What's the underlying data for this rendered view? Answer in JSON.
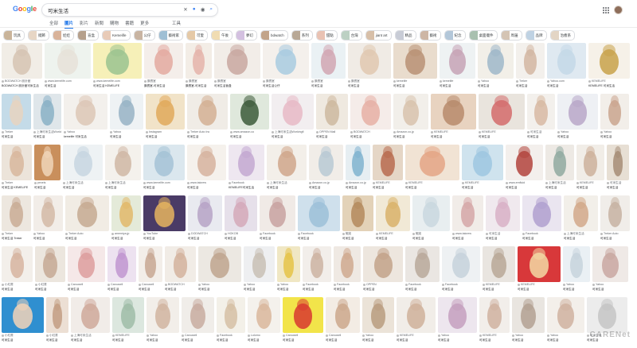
{
  "header": {
    "logo_letters": [
      {
        "char": "G",
        "color": "#4285F4"
      },
      {
        "char": "o",
        "color": "#EA4335"
      },
      {
        "char": "o",
        "color": "#FBBC05"
      },
      {
        "char": "g",
        "color": "#4285F4"
      },
      {
        "char": "l",
        "color": "#34A853"
      },
      {
        "char": "e",
        "color": "#EA4335"
      }
    ],
    "search_value": "可米生活",
    "icons": [
      "clear-icon",
      "mic-icon",
      "lens-icon",
      "search-icon"
    ]
  },
  "tabs": [
    "全部",
    "圖片",
    "影片",
    "新聞",
    "購物",
    "書籍",
    "更多"
  ],
  "active_tab": "圖片",
  "tools_label": "工具",
  "chips": [
    {
      "label": "玩具",
      "color": "#c9b49a"
    },
    {
      "label": "擺飾",
      "color": "#e7d6c5"
    },
    {
      "label": "娃娃",
      "color": "#d9b39a"
    },
    {
      "label": "盲盒",
      "color": "#b5a08c"
    },
    {
      "label": "Kemelife",
      "color": "#e8cbb8"
    },
    {
      "label": "公仔",
      "color": "#c8b4a2"
    },
    {
      "label": "藝術家",
      "color": "#9fbfd4"
    },
    {
      "label": "可愛",
      "color": "#e5c9a7"
    },
    {
      "label": "午後",
      "color": "#f0dcb2"
    },
    {
      "label": "夢幻",
      "color": "#d3c0e0"
    },
    {
      "label": "bdwatch",
      "color": "#c2a48a"
    },
    {
      "label": "系列",
      "color": "#b8a896"
    },
    {
      "label": "甜點",
      "color": "#e9c2b3"
    },
    {
      "label": "台灣",
      "color": "#bcd0c3"
    },
    {
      "label": "jiant art",
      "color": "#d7bfa8"
    },
    {
      "label": "精品",
      "color": "#c8ccd6"
    },
    {
      "label": "藝術",
      "color": "#cdb6a5"
    },
    {
      "label": "紀念",
      "color": "#b3c7d9"
    },
    {
      "label": "桌面擺件",
      "color": "#a9c0b0"
    },
    {
      "label": "周邊",
      "color": "#d4c4b4"
    },
    {
      "label": "品牌",
      "color": "#bfd2e3"
    },
    {
      "label": "治癒系",
      "color": "#e3d5c5"
    }
  ],
  "results": [
    [
      {
        "source": "BODWATCH 設計館",
        "title": "BODWATCH 設計館可米生活",
        "bg": "#f1ede6",
        "fg": "#d6c3b2"
      },
      {
        "source": "www.kemelife.com",
        "title": "可米生活",
        "bg": "#eef3ee",
        "fg": "#e6e1d8"
      },
      {
        "source": "www.kemelife.com",
        "title": "可米生活 KEMELIFE",
        "bg": "#f6f0b8",
        "fg": "#9ac38f"
      },
      {
        "source": "讚賣室",
        "title": "讚賣室-可米生活",
        "bg": "#f4eeea",
        "fg": "#e3a9a0"
      },
      {
        "source": "讚賣室",
        "title": "讚賣室-可米生活",
        "bg": "#f3ede6",
        "fg": "#e4b3a9"
      },
      {
        "source": "讚賣室",
        "title": "可米生活盲盒",
        "bg": "#f2ede8",
        "fg": "#c9a7a0"
      },
      {
        "source": "讚賣室",
        "title": "可米生活公仔",
        "bg": "#f4f0ec",
        "fg": "#a8cbe0"
      },
      {
        "source": "讚賣室",
        "title": "可米生活",
        "bg": "#eaf1f4",
        "fg": "#d1a6b2"
      },
      {
        "source": "讚賣室",
        "title": "可米生活",
        "bg": "#f0ebe5",
        "fg": "#e0c8b0"
      },
      {
        "source": "kemelife",
        "title": "可米生活",
        "bg": "#e9dccd",
        "fg": "#b89174"
      },
      {
        "source": "kemelife",
        "title": "可米生活",
        "bg": "#eef2f3",
        "fg": "#c6a3b5"
      },
      {
        "source": "Yahoo",
        "title": "可米生活",
        "bg": "#f2efe8",
        "fg": "#9fb7c9"
      },
      {
        "source": "Treker",
        "title": "可米生活",
        "bg": "#f3f0ec",
        "fg": "#d2b6a2"
      },
      {
        "source": "Yahoo.com",
        "title": "可米生活",
        "bg": "#dfe9f1",
        "fg": "#c4d8e8"
      },
      {
        "source": "KEMELIFE",
        "title": "KEMELIFE 可米生活",
        "bg": "#f6f1e8",
        "fg": "#c8a24a"
      }
    ],
    [
      {
        "source": "Treker",
        "title": "可米生活",
        "bg": "#c4dbe8",
        "fg": "#e8d3c0"
      },
      {
        "source": "上海可米生活Workingfi",
        "title": "可米生活",
        "bg": "#dfe6ea",
        "fg": "#8ab0c6"
      },
      {
        "source": "Yahoo",
        "title": "kemelife 可米生活",
        "bg": "#f3f0ec",
        "fg": "#dcc7b6"
      },
      {
        "source": "Yahoo",
        "title": "可米生活",
        "bg": "#eef2f4",
        "fg": "#96b3c4"
      },
      {
        "source": "Instagram",
        "title": "可米生活",
        "bg": "#f1e3c8",
        "fg": "#e1a95b"
      },
      {
        "source": "Treker Auto Inc",
        "title": "可米生活",
        "bg": "#f0ece6",
        "fg": "#d4b093"
      },
      {
        "source": "www.amazon.co",
        "title": "可米生活",
        "bg": "#dfe8dc",
        "fg": "#3c5a3a"
      },
      {
        "source": "上海可米生活Workingfi",
        "title": "可米生活",
        "bg": "#f2eef0",
        "fg": "#e7b9c6"
      },
      {
        "source": "OPPEN Mall",
        "title": "可米生活",
        "bg": "#efe9e0",
        "fg": "#cdb89f"
      },
      {
        "source": "BODWATCH",
        "title": "可米生活",
        "bg": "#f5ece9",
        "fg": "#e6b0a5"
      },
      {
        "source": "Amazon.co.jp",
        "title": "可米生活",
        "bg": "#f2efea",
        "fg": "#d8c2ad"
      },
      {
        "source": "KEMELIFE",
        "title": "可米生活",
        "bg": "#e8d3c0",
        "fg": "#b78a6b"
      },
      {
        "source": "KEMELIFE",
        "title": "可米生活",
        "bg": "#e9e4dd",
        "fg": "#d36b6b"
      },
      {
        "source": "可米生活",
        "title": "可米生活",
        "bg": "#f3f0ec",
        "fg": "#d7b9a3"
      },
      {
        "source": "Yahoo",
        "title": "可米生活",
        "bg": "#eef0f4",
        "fg": "#b8a7c8"
      },
      {
        "source": "Yahoo",
        "title": "可米生活",
        "bg": "#f2eee9",
        "fg": "#caa48e"
      }
    ],
    [
      {
        "source": "Treker",
        "title": "可米生活 KEMELIFE",
        "bg": "#ece4da",
        "fg": "#d8b79c"
      },
      {
        "source": "pexels",
        "title": "可米生活",
        "bg": "#c98f5c",
        "fg": "#f0d6b8"
      },
      {
        "source": "上海可米生活",
        "title": "可米生活",
        "bg": "#eef2f4",
        "fg": "#c7d6e0"
      },
      {
        "source": "上海可米生活",
        "title": "可米生活",
        "bg": "#f4f1ec",
        "fg": "#cfb7a5"
      },
      {
        "source": "www.kemelife.com",
        "title": "可米生活",
        "bg": "#dbe7ee",
        "fg": "#a4c2d6"
      },
      {
        "source": "www.taicrew",
        "title": "可米生活",
        "bg": "#f5f1ec",
        "fg": "#d6b39f"
      },
      {
        "source": "Facebook",
        "title": "KEMELIFE可米生活",
        "bg": "#eee7f0",
        "fg": "#c3a8d1"
      },
      {
        "source": "上海可米生活",
        "title": "可米生活",
        "bg": "#f3efe9",
        "fg": "#cfa68b"
      },
      {
        "source": "Amazon.co.jp",
        "title": "可米生活",
        "bg": "#f1ede8",
        "fg": "#b8c9d4"
      },
      {
        "source": "Amazon.co.jp",
        "title": "可米生活",
        "bg": "#e6eef2",
        "fg": "#7fb3cf"
      },
      {
        "source": "KEMELIFE",
        "title": "可米生活",
        "bg": "#e5d6c6",
        "fg": "#b86b4f"
      },
      {
        "source": "KEMELIFE",
        "title": "可米生活",
        "bg": "#f1e3d4",
        "fg": "#e4a585"
      },
      {
        "source": "KEMELIFE",
        "title": "可米生活",
        "bg": "#cfe3ee",
        "fg": "#9ec7e0"
      },
      {
        "source": "www.emfluid",
        "title": "可米生活",
        "bg": "#f3efec",
        "fg": "#b1433d"
      },
      {
        "source": "上海可米生活",
        "title": "可米生活",
        "bg": "#ede9e4",
        "fg": "#8fa9a0"
      },
      {
        "source": "KEMELIFE",
        "title": "可米生活",
        "bg": "#f1ede7",
        "fg": "#cdb09b"
      },
      {
        "source": "可米生活",
        "title": "可米生活",
        "bg": "#e7dfd4",
        "fg": "#a68d76"
      }
    ],
    [
      {
        "source": "Treker",
        "title": "可米生活 Treker",
        "bg": "#ede7df",
        "fg": "#c9ab95"
      },
      {
        "source": "Yahoo",
        "title": "可米生活",
        "bg": "#f2ede8",
        "fg": "#d4b8a6"
      },
      {
        "source": "Treker Auto",
        "title": "可米生活",
        "bg": "#f1ece4",
        "fg": "#c6aa92"
      },
      {
        "source": "amemiya.jp",
        "title": "可米生活",
        "bg": "#e4ead9",
        "fg": "#e2b86a"
      },
      {
        "source": "YouTube",
        "title": "可米生活",
        "bg": "#4a3b66",
        "fg": "#e6b55f"
      },
      {
        "source": "DODWATCH",
        "title": "可米生活",
        "bg": "#e9eaf0",
        "fg": "#b6a3c6"
      },
      {
        "source": "HOKOB",
        "title": "可米生活",
        "bg": "#e6e0ea",
        "fg": "#d4a8b9"
      },
      {
        "source": "Facebook",
        "title": "可米生活",
        "bg": "#f0eae6",
        "fg": "#c8a2a0"
      },
      {
        "source": "Facebook",
        "title": "可米生活",
        "bg": "#cfe0ec",
        "fg": "#9cc0d8"
      },
      {
        "source": "蝦皮",
        "title": "可米生活",
        "bg": "#e3d2b8",
        "fg": "#b48a5c"
      },
      {
        "source": "KEMELIFE",
        "title": "可米生活",
        "bg": "#f1e9d6",
        "fg": "#d9b26a"
      },
      {
        "source": "蝦皮",
        "title": "可米生活",
        "bg": "#e8eef0",
        "fg": "#c9d7df"
      },
      {
        "source": "www.taicrew",
        "title": "可米生活",
        "bg": "#f1ece8",
        "fg": "#d5a7a7"
      },
      {
        "source": "可米生活",
        "title": "可米生活",
        "bg": "#f0e9ee",
        "fg": "#d8b0c6"
      },
      {
        "source": "Facebook",
        "title": "可米生活",
        "bg": "#eae5f0",
        "fg": "#b0a0cf"
      },
      {
        "source": "上海可米生活",
        "title": "可米生活",
        "bg": "#f2efe9",
        "fg": "#d2a889"
      },
      {
        "source": "Treker Auto",
        "title": "可米生活",
        "bg": "#f0ede9",
        "fg": "#c7b2a2"
      }
    ],
    [
      {
        "source": "小紅書",
        "title": "可米生活",
        "bg": "#f3efea",
        "fg": "#d6b4a0"
      },
      {
        "source": "小紅書",
        "title": "可米生活",
        "bg": "#ece6de",
        "fg": "#c6a894"
      },
      {
        "source": "Carousell",
        "title": "可米生活",
        "bg": "#f5e8e8",
        "fg": "#dd9d9d"
      },
      {
        "source": "Carousell",
        "title": "可米生活",
        "bg": "#ede2f0",
        "fg": "#c095d0"
      },
      {
        "source": "Carousell",
        "title": "可米生活",
        "bg": "#f3eee9",
        "fg": "#c7a793"
      },
      {
        "source": "BODWATCH",
        "title": "可米生活",
        "bg": "#f1ece6",
        "fg": "#d3b39c"
      },
      {
        "source": "Yahoo",
        "title": "可米生活",
        "bg": "#ece8e2",
        "fg": "#bfa48e"
      },
      {
        "source": "Yahoo",
        "title": "可米生活",
        "bg": "#eeeff1",
        "fg": "#c8c0b5"
      },
      {
        "source": "Yahoo",
        "title": "可米生活",
        "bg": "#f0e7c4",
        "fg": "#e5c348"
      },
      {
        "source": "Facebook",
        "title": "可米生活",
        "bg": "#f2eeea",
        "fg": "#cdb3a2"
      },
      {
        "source": "Facebook",
        "title": "可米生活",
        "bg": "#efe9e3",
        "fg": "#cfa98f"
      },
      {
        "source": "OPPEN",
        "title": "可米生活",
        "bg": "#ede6de",
        "fg": "#c2a28a"
      },
      {
        "source": "Facebook",
        "title": "可米生活",
        "bg": "#eae6e2",
        "fg": "#b8a89a"
      },
      {
        "source": "Facebook",
        "title": "可米生活",
        "bg": "#eef1f3",
        "fg": "#c6d2da"
      },
      {
        "source": "KEMELIFE",
        "title": "可米生活",
        "bg": "#e9e5e0",
        "fg": "#b8a897"
      },
      {
        "source": "KEMELIFE",
        "title": "可米生活",
        "bg": "#d8383a",
        "fg": "#f3d9a4"
      },
      {
        "source": "Yahoo",
        "title": "可米生活",
        "bg": "#eaf0f4",
        "fg": "#c7d3dc"
      },
      {
        "source": "Yahoo",
        "title": "可米生活",
        "bg": "#efe9e6",
        "fg": "#c9a7a1"
      }
    ],
    [
      {
        "source": "小紅書",
        "title": "可米生活",
        "bg": "#2f8fd0",
        "fg": "#f2d3b8"
      },
      {
        "source": "小紅書",
        "title": "可米生活",
        "bg": "#ecdfd4",
        "fg": "#c39e83"
      },
      {
        "source": "上海可米生活",
        "title": "可米生活",
        "bg": "#f1ece8",
        "fg": "#cfa99a"
      },
      {
        "source": "KEMELIFE",
        "title": "可米生活",
        "bg": "#dce7df",
        "fg": "#9fbca8"
      },
      {
        "source": "Yahoo",
        "title": "可米生活",
        "bg": "#f2eee9",
        "fg": "#d1b4a0"
      },
      {
        "source": "Carousell",
        "title": "可米生活",
        "bg": "#f0ede9",
        "fg": "#c8aca0"
      },
      {
        "source": "Facebook",
        "title": "可米生活",
        "bg": "#f3f0e8",
        "fg": "#d5c0a4"
      },
      {
        "source": "Lolomo",
        "title": "可米生活",
        "bg": "#f4f1ec",
        "fg": "#d9b79c"
      },
      {
        "source": "Carousell",
        "title": "可米生活",
        "bg": "#f2e44a",
        "fg": "#d8382f"
      },
      {
        "source": "Carousell",
        "title": "可米生活",
        "bg": "#f3ece4",
        "fg": "#cba88c"
      },
      {
        "source": "Yahoo",
        "title": "可米生活",
        "bg": "#ebe3d8",
        "fg": "#b99c7f"
      },
      {
        "source": "KEMELIFE",
        "title": "可米生活",
        "bg": "#f1ede8",
        "fg": "#cfb09a"
      },
      {
        "source": "Yahoo",
        "title": "可米生活",
        "bg": "#ede6ee",
        "fg": "#c49fbe"
      },
      {
        "source": "KEMELIFE",
        "title": "可米生活",
        "bg": "#f2eeea",
        "fg": "#d0b2a0"
      },
      {
        "source": "Yahoo",
        "title": "可米生活",
        "bg": "#e9e5e0",
        "fg": "#b3a192"
      },
      {
        "source": "Yahoo",
        "title": "可米生活",
        "bg": "#f3efea",
        "fg": "#cfb2a0"
      },
      {
        "source": "可米生活",
        "title": "可米生活",
        "bg": "#ececec",
        "fg": "#c5c5c5"
      }
    ]
  ],
  "tile_widths": [
    [
      58,
      66,
      70,
      56,
      38,
      66,
      66,
      50,
      62,
      63,
      52,
      52,
      42,
      56,
      60
    ],
    [
      41,
      38,
      60,
      46,
      54,
      56,
      54,
      58,
      44,
      56,
      48,
      62,
      64,
      38,
      56,
      40
    ],
    [
      44,
      38,
      58,
      52,
      60,
      56,
      52,
      58,
      50,
      36,
      44,
      78,
      60,
      54,
      42,
      40,
      32
    ],
    [
      38,
      38,
      56,
      38,
      54,
      44,
      42,
      46,
      54,
      40,
      44,
      48,
      40,
      44,
      50,
      44,
      38
    ],
    [
      44,
      42,
      52,
      40,
      34,
      44,
      60,
      44,
      32,
      40,
      38,
      56,
      48,
      54,
      46,
      60,
      38,
      50
    ],
    [
      56,
      30,
      52,
      42,
      44,
      44,
      38,
      44,
      54,
      46,
      42,
      52,
      52,
      40,
      44,
      50,
      54
    ]
  ],
  "watermark": "CARENet"
}
